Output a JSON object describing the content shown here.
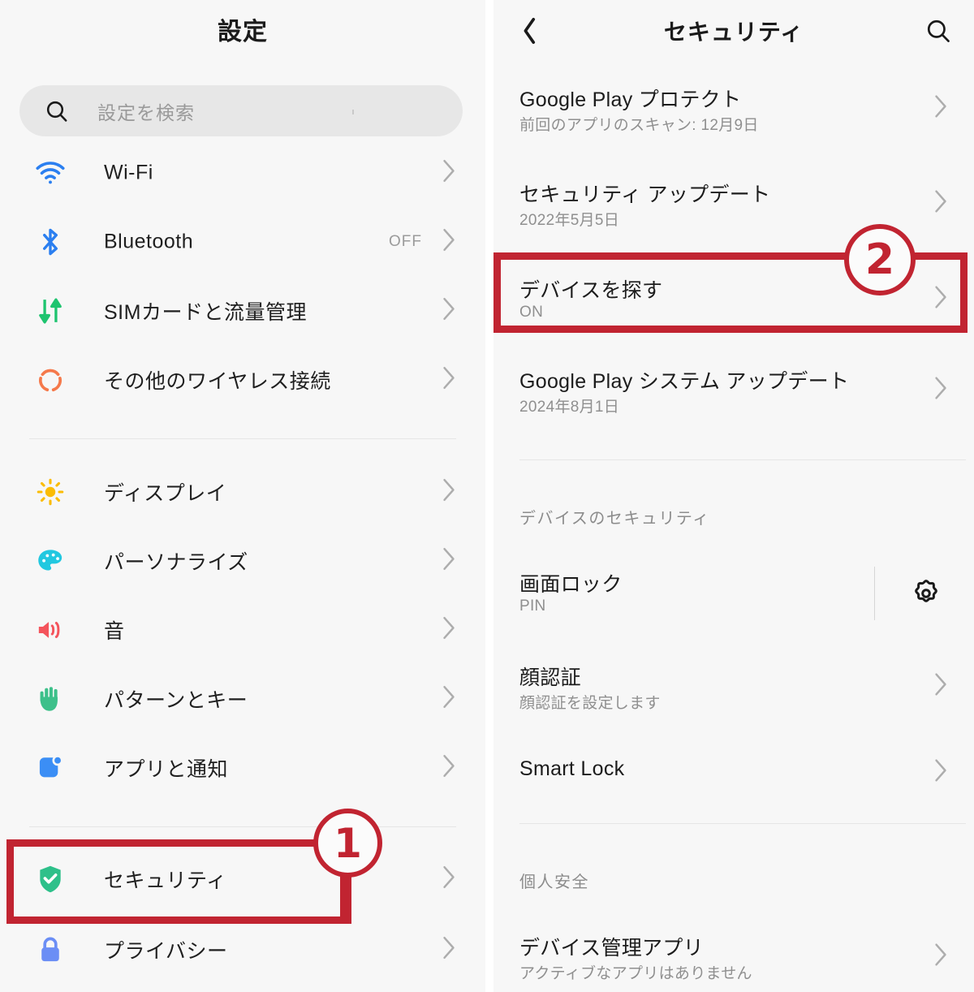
{
  "left_panel": {
    "title": "設定",
    "search": {
      "placeholder": "設定を検索",
      "icon": "search-icon"
    },
    "groups": [
      {
        "items": [
          {
            "label": "Wi-Fi",
            "value": "",
            "icon": "wifi-icon"
          },
          {
            "label": "Bluetooth",
            "value": "OFF",
            "icon": "bluetooth-icon"
          },
          {
            "label": "SIMカードと流量管理",
            "value": "",
            "icon": "sim-data-icon"
          },
          {
            "label": "その他のワイヤレス接続",
            "value": "",
            "icon": "wireless-connection-icon"
          }
        ]
      },
      {
        "items": [
          {
            "label": "ディスプレイ",
            "value": "",
            "icon": "display-brightness-icon"
          },
          {
            "label": "パーソナライズ",
            "value": "",
            "icon": "personalize-palette-icon"
          },
          {
            "label": "音",
            "value": "",
            "icon": "sound-speaker-icon"
          },
          {
            "label": "パターンとキー",
            "value": "",
            "icon": "gesture-hand-icon"
          },
          {
            "label": "アプリと通知",
            "value": "",
            "icon": "apps-notification-icon"
          }
        ]
      },
      {
        "items": [
          {
            "label": "セキュリティ",
            "value": "",
            "icon": "security-shield-icon"
          },
          {
            "label": "プライバシー",
            "value": "",
            "icon": "privacy-lock-icon"
          }
        ]
      }
    ]
  },
  "right_panel": {
    "title": "セキュリティ",
    "back_icon": "back-chevron-icon",
    "search_icon": "search-icon",
    "rows": [
      {
        "title": "Google Play プロテクト",
        "subtitle": "前回のアプリのスキャン: 12月9日"
      },
      {
        "title": "セキュリティ アップデート",
        "subtitle": "2022年5月5日"
      },
      {
        "title": "デバイスを探す",
        "subtitle": "ON"
      },
      {
        "title": "Google Play システム アップデート",
        "subtitle": "2024年8月1日"
      }
    ],
    "device_security": {
      "header": "デバイスのセキュリティ",
      "rows": [
        {
          "title": "画面ロック",
          "subtitle": "PIN",
          "trailing_icon": "gear-icon"
        },
        {
          "title": "顔認証",
          "subtitle": "顔認証を設定します"
        },
        {
          "title": "Smart Lock",
          "subtitle": ""
        }
      ]
    },
    "personal_safety": {
      "header": "個人安全",
      "rows": [
        {
          "title": "デバイス管理アプリ",
          "subtitle": "アクティブなアプリはありません"
        }
      ]
    }
  },
  "annotations": [
    {
      "number": "①",
      "digit": "1",
      "target": "セキュリティ"
    },
    {
      "number": "②",
      "digit": "2",
      "target": "デバイスを探す"
    }
  ],
  "colors": {
    "annotation_red": "#c12431",
    "panel_background": "#f7f7f7",
    "wifi_blue": "#2b7ff0",
    "bluetooth_blue": "#2b7ff0",
    "sim_green": "#1ec46f",
    "wireless_orange": "#f5794b",
    "display_yellow": "#fbbc05",
    "palette_cyan": "#22c8e0",
    "sound_red": "#f4545c",
    "gesture_green": "#3dc08a",
    "apps_blue": "#3b8ef5",
    "shield_green": "#2ec08a",
    "lock_blue": "#6b8ef5"
  }
}
